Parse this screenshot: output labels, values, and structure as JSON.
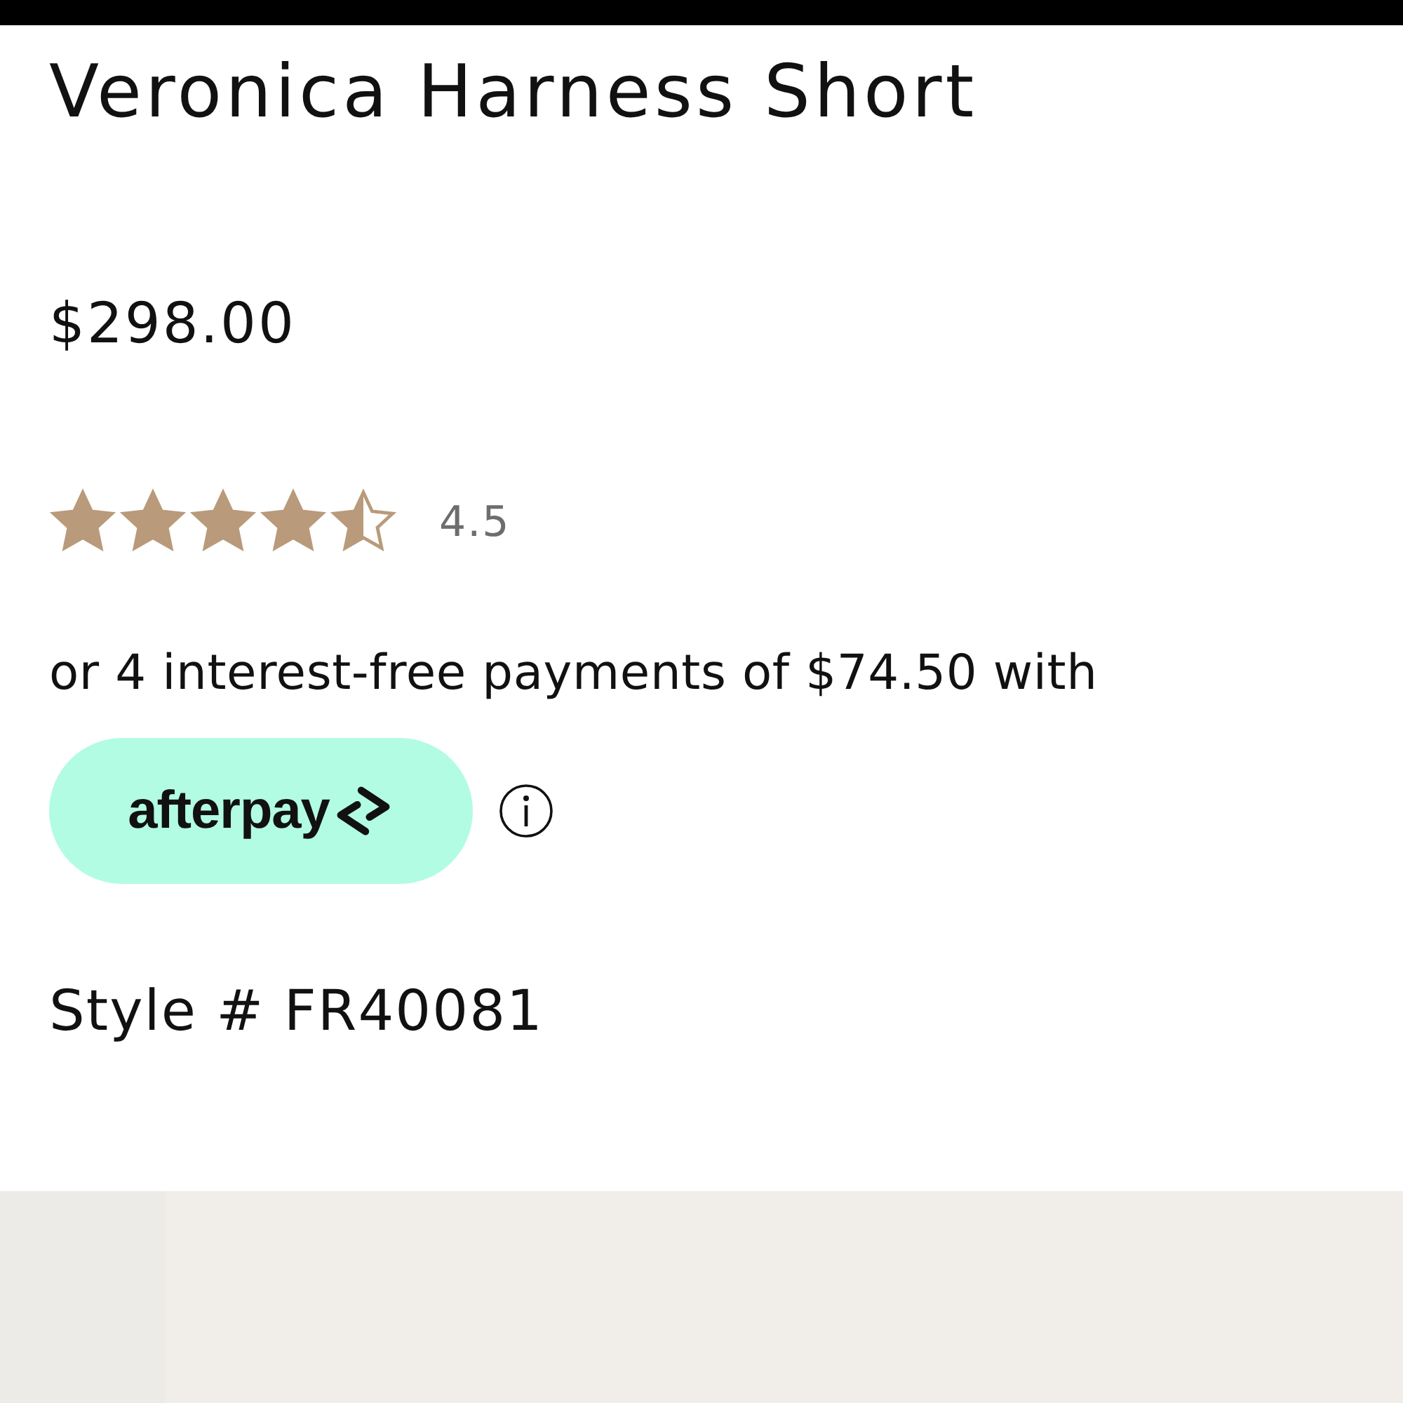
{
  "product": {
    "title": "Veronica Harness Short",
    "price": "$298.00",
    "stars": 4.5,
    "rating": "4.5",
    "installments": "or 4 interest-free payments of $74.50 with",
    "provider": "afterpay",
    "style": "Style # FR40081"
  }
}
